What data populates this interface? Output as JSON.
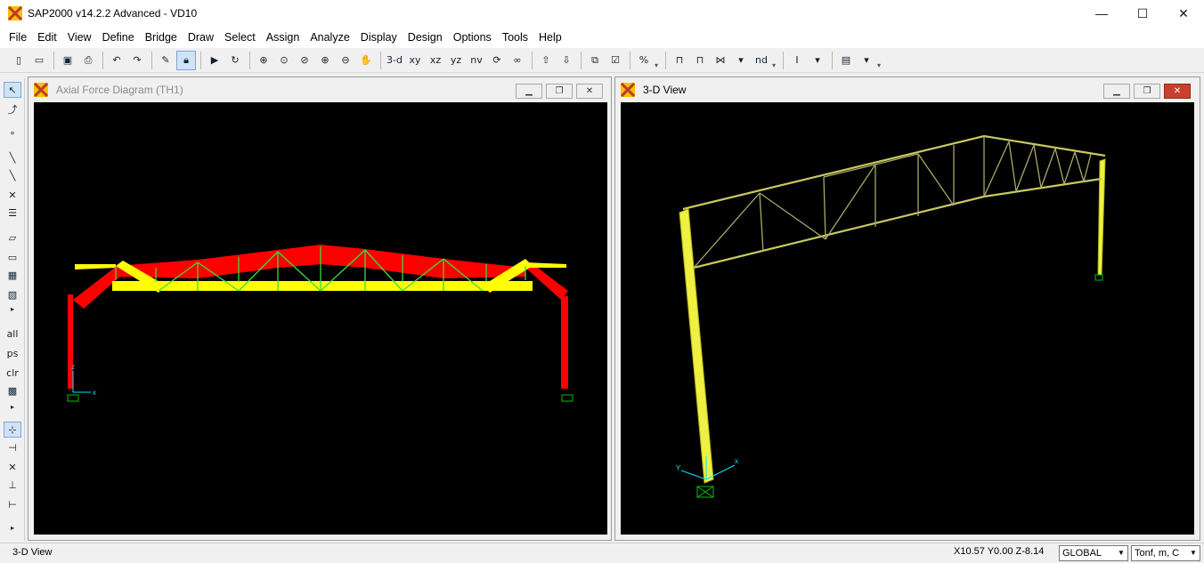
{
  "window": {
    "title": "SAP2000 v14.2.2 Advanced  - VD10",
    "minimize": "—",
    "maximize": "☐",
    "close": "✕"
  },
  "menu": [
    "File",
    "Edit",
    "View",
    "Define",
    "Bridge",
    "Draw",
    "Select",
    "Assign",
    "Analyze",
    "Display",
    "Design",
    "Options",
    "Tools",
    "Help"
  ],
  "toolbar": {
    "view_3d": "3-d",
    "view_xy": "xy",
    "view_xz": "xz",
    "view_yz": "yz",
    "view_nv": "nv",
    "view_nd": "nd"
  },
  "left_toolbar": {
    "all": "all",
    "ps": "ps",
    "clr": "clr"
  },
  "left_window": {
    "title": "Axial Force Diagram   (TH1)",
    "active": false,
    "axis_x": "x",
    "axis_z": "z"
  },
  "right_window": {
    "title": "3-D View",
    "active": true,
    "axis_x": "x",
    "axis_y": "Y"
  },
  "status": {
    "left_text": "3-D View",
    "coordinates": "X10.57  Y0.00  Z-8.14",
    "coord_system": "GLOBAL",
    "units": "Tonf, m, C"
  },
  "colors": {
    "compression": "#ff0000",
    "tension": "#ffff00",
    "frame_3d": "#c8c860",
    "support": "#00c000",
    "active_close": "#c9402f"
  },
  "icons": {
    "app": "sap2000-logo-icon",
    "pointer": "pointer-icon"
  }
}
